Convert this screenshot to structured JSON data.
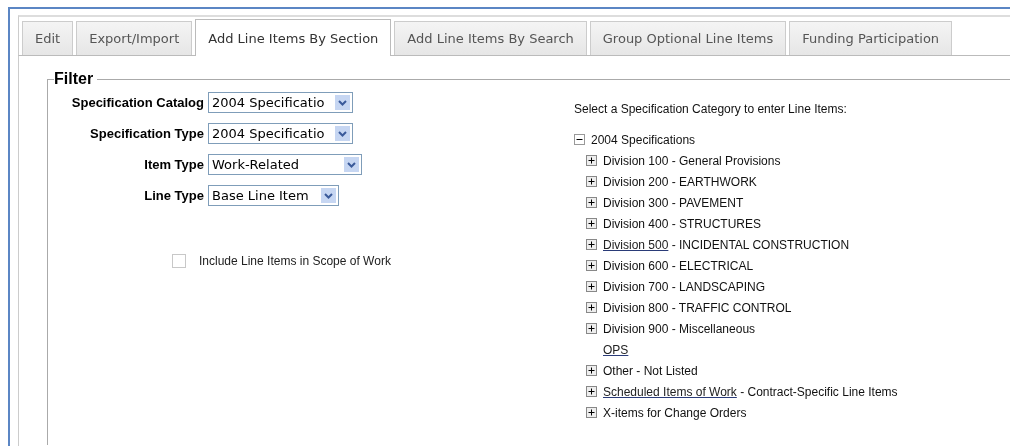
{
  "tabs": [
    {
      "label": "Edit",
      "selected": false
    },
    {
      "label": "Export/Import",
      "selected": false
    },
    {
      "label": "Add Line Items By Section",
      "selected": true
    },
    {
      "label": "Add Line Items By Search",
      "selected": false
    },
    {
      "label": "Group Optional Line Items",
      "selected": false
    },
    {
      "label": "Funding Participation",
      "selected": false
    }
  ],
  "filter": {
    "legend": "Filter",
    "fields": [
      {
        "label": "Specification Catalog",
        "value": "2004 Specificatio",
        "kind": "narrow"
      },
      {
        "label": "Specification Type",
        "value": "2004 Specificatio",
        "kind": "narrow"
      },
      {
        "label": "Item Type",
        "value": "Work-Related",
        "kind": "wide"
      },
      {
        "label": "Line Type",
        "value": "Base Line Item",
        "kind": "short"
      }
    ],
    "scope_checkbox": {
      "label": "Include Line Items in Scope of Work",
      "checked": false
    },
    "tree_prompt": "Select a Specification Category to enter Line Items:",
    "tree": {
      "text": "2004 Specifications",
      "expanded": true,
      "children": [
        {
          "kind": "branch",
          "expanded": false,
          "text": "Division 100 - General Provisions"
        },
        {
          "kind": "branch",
          "expanded": false,
          "text": "Division 200 - EARTHWORK"
        },
        {
          "kind": "branch",
          "expanded": false,
          "text": "Division 300 - PAVEMENT"
        },
        {
          "kind": "branch",
          "expanded": false,
          "text": "Division 400 - STRUCTURES"
        },
        {
          "kind": "branch",
          "expanded": false,
          "link": "Division 500",
          "text": " - INCIDENTAL CONSTRUCTION"
        },
        {
          "kind": "branch",
          "expanded": false,
          "text": "Division 600 - ELECTRICAL"
        },
        {
          "kind": "branch",
          "expanded": false,
          "text": "Division 700 - LANDSCAPING"
        },
        {
          "kind": "branch",
          "expanded": false,
          "text": "Division 800 - TRAFFIC CONTROL"
        },
        {
          "kind": "branch",
          "expanded": false,
          "text": "Division 900 - Miscellaneous"
        },
        {
          "kind": "leaf",
          "link": "OPS"
        },
        {
          "kind": "branch",
          "expanded": false,
          "text": "Other - Not Listed"
        },
        {
          "kind": "branch",
          "expanded": false,
          "link": "Scheduled Items of Work",
          "text": " - Contract-Specific Line Items"
        },
        {
          "kind": "branch",
          "expanded": false,
          "text": "X-items for Change Orders"
        }
      ]
    }
  }
}
